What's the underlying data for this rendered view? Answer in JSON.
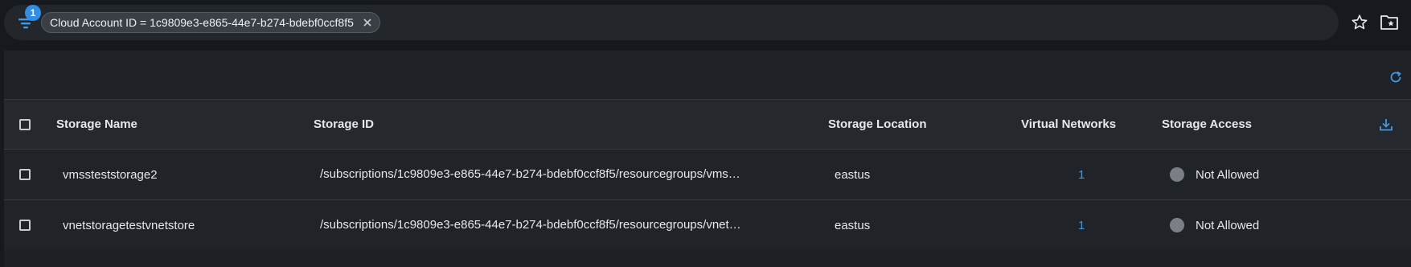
{
  "filter": {
    "badge_count": "1",
    "chip_label": "Cloud Account ID = 1c9809e3-e865-44e7-b274-bdebf0ccf8f5"
  },
  "top_icons": [
    "star-icon",
    "folder-star-icon"
  ],
  "table": {
    "columns": [
      "Storage Name",
      "Storage ID",
      "Storage Location",
      "Virtual Networks",
      "Storage Access"
    ],
    "rows": [
      {
        "name": "vmssteststorage2",
        "id": "/subscriptions/1c9809e3-e865-44e7-b274-bdebf0ccf8f5/resourcegroups/vms…",
        "location": "eastus",
        "vnets": "1",
        "access": "Not Allowed"
      },
      {
        "name": "vnetstoragetestvnetstore",
        "id": "/subscriptions/1c9809e3-e865-44e7-b274-bdebf0ccf8f5/resourcegroups/vnet…",
        "location": "eastus",
        "vnets": "1",
        "access": "Not Allowed"
      }
    ]
  },
  "colors": {
    "accent": "#3d9ae8",
    "badge": "#2f8fe6",
    "status_dot": "#7a7f86"
  }
}
